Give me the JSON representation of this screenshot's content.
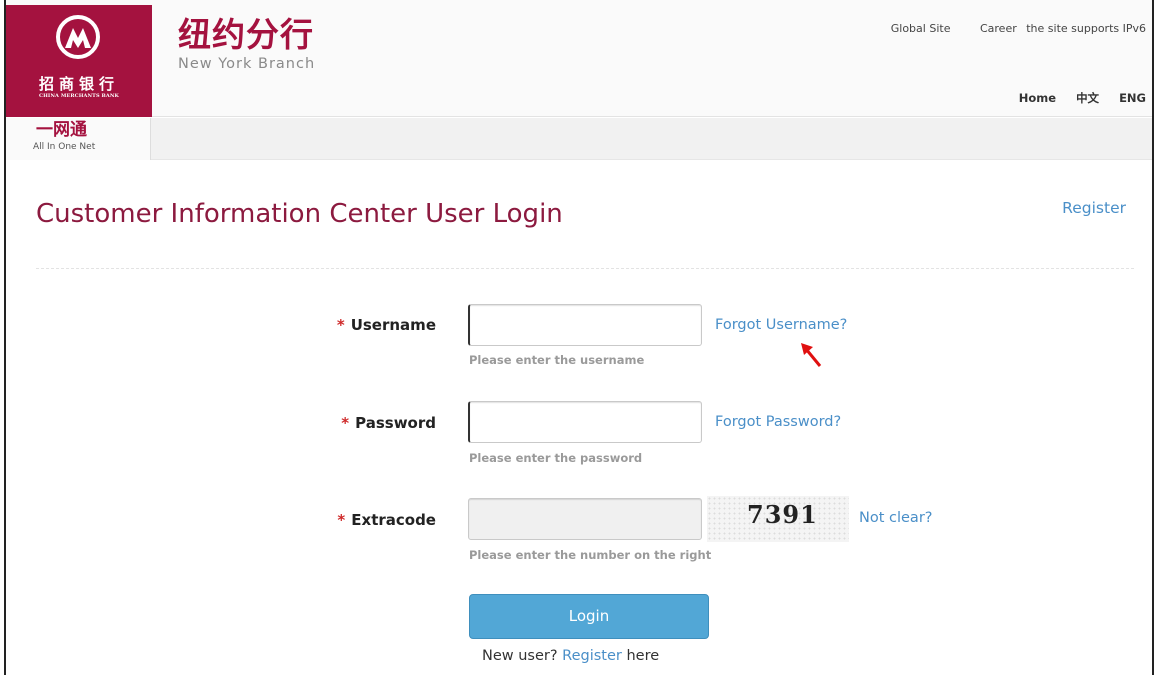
{
  "header": {
    "logo_cn": "招商银行",
    "logo_en": "CHINA MERCHANTS BANK",
    "branch_cn": "纽约分行",
    "branch_en": "New York Branch",
    "top_links": {
      "global_site": "Global Site",
      "career": "Career",
      "ipv6": "the site supports IPv6"
    },
    "nav": {
      "home": "Home",
      "chinese": "中文",
      "english": "ENG"
    },
    "brand_color": "#a4123f"
  },
  "subbar": {
    "aio_cn": "一网通",
    "aio_en": "All In One Net"
  },
  "main": {
    "title": "Customer Information Center User Login",
    "register_link": "Register",
    "username": {
      "label": "Username",
      "value": "",
      "hint": "Please enter the username",
      "forgot": "Forgot Username?"
    },
    "password": {
      "label": "Password",
      "value": "",
      "hint": "Please enter the password",
      "forgot": "Forgot Password?"
    },
    "extracode": {
      "label": "Extracode",
      "value": "",
      "hint": "Please enter the number on the right",
      "captcha": "7391",
      "not_clear": "Not clear?"
    },
    "login_button": "Login",
    "new_user": {
      "prefix": "New user?",
      "register": "Register",
      "suffix": "here"
    },
    "required_mark": "*"
  }
}
